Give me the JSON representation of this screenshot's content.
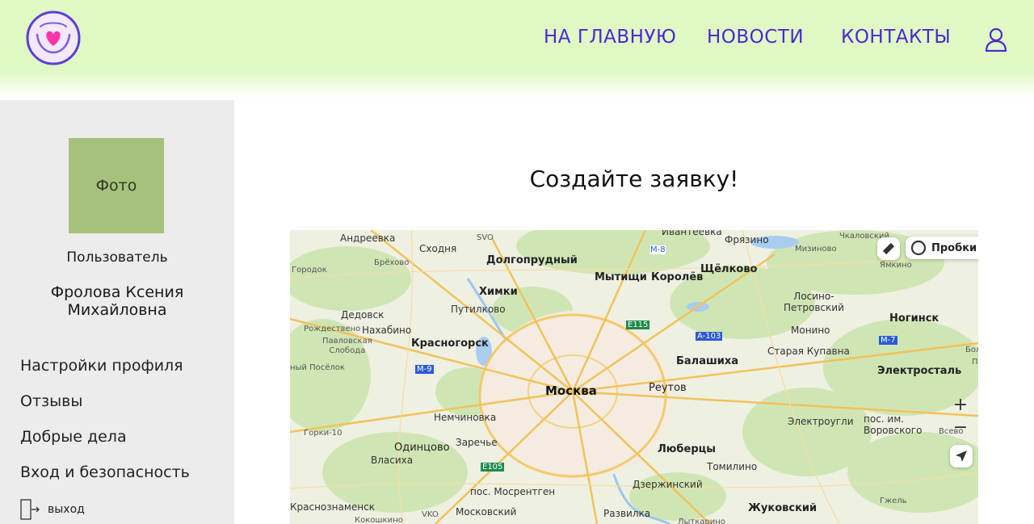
{
  "header": {
    "nav": [
      {
        "label": "НА ГЛАВНУЮ"
      },
      {
        "label": "НОВОСТИ"
      },
      {
        "label": "КОНТАКТЫ"
      }
    ]
  },
  "sidebar": {
    "photo_label": "Фото",
    "role": "Пользователь",
    "name": "Фролова Ксения Михайловна",
    "menu": [
      {
        "label": "Настройки профиля"
      },
      {
        "label": "Отзывы"
      },
      {
        "label": "Добрые дела"
      },
      {
        "label": "Вход и безопасность"
      }
    ],
    "logout_label": "выход"
  },
  "main": {
    "title": "Создайте заявку!"
  },
  "map": {
    "traffic_label": "Пробки",
    "zoom_in": "+",
    "zoom_out": "−",
    "labels": {
      "andreevka": "Андреевка",
      "skhodnya": "Сходня",
      "svo": "SVO",
      "ivanteevka": "Ивантеевка",
      "fryazino": "Фрязино",
      "chkalovsky": "Чкаловский",
      "brekhovo": "Брёхово",
      "dolgoprudny": "Долгопрудный",
      "m8": "M-8",
      "shchyolkovo": "Щёлково",
      "mizinovo": "Мизиново",
      "yamkino": "Ямкино",
      "gorodok": "Городок",
      "khimki": "Химки",
      "mytishchi": "Мытищи",
      "korolyov": "Королёв",
      "losino": "Лосино-\nПетровский",
      "dedovsk": "Дедовск",
      "putilkovo": "Путилково",
      "e115": "E115",
      "a103": "A-103",
      "rozhdestveno": "Рождествено",
      "nakhabino": "Нахабино",
      "monino": "Монино",
      "noginsk": "Ногинск",
      "pavlovskaya": "Павловская\nСлобода",
      "krasnogorsk": "Красногорск",
      "balashikha": "Балашиха",
      "staraya_kupavna": "Старая Купавна",
      "m7": "M-7",
      "posyolok": "ный Посёлок",
      "m9": "M-9",
      "elektrostal": "Электросталь",
      "moskva": "Москва",
      "reutov": "Реутов",
      "nemchinovka": "Немчиновка",
      "elektrougli": "Электроугли",
      "voskresky": "пос. им.\nВоровского",
      "vsevo": "Всево",
      "gorki": "Горки-10",
      "odintsovo": "Одинцово",
      "zarechye": "Заречье",
      "lyubertsy": "Люберцы",
      "vlasikha": "Власиха",
      "tomilino": "Томилино",
      "e105": "E105",
      "mosrentgen": "пос. Мосрентген",
      "dzerzhinsky": "Дзержинский",
      "krasnoznamensk": "Краснознаменск",
      "vko": "VKO",
      "moskovsky": "Московский",
      "razvilka": "Развилка",
      "zhukovsky": "Жуковский",
      "gzhel": "Гжель",
      "kokoshkino": "Кокошкино",
      "lytkarino": "Лыткарино",
      "bol": "Бол",
      "p": "П"
    }
  }
}
